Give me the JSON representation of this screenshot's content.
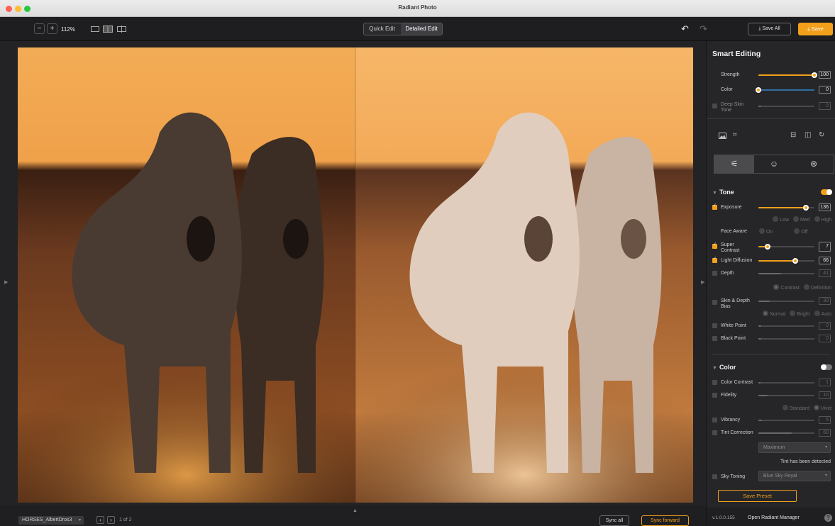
{
  "window": {
    "title": "Radiant Photo"
  },
  "toolbar": {
    "zoom_out": "−",
    "zoom_in": "+",
    "zoom_level": "112%",
    "mode_quick": "Quick Edit",
    "mode_detailed": "Detailed Edit",
    "undo": "↶",
    "redo": "↷",
    "save_all": "⤓ Save All",
    "save": "⤓ Save"
  },
  "bottom": {
    "filename": "HORSES_AlbertDros3",
    "page_prev": "‹",
    "page_next": "›",
    "page_count": "1 of 2",
    "sync_all": "Sync all",
    "sync_forward": "Sync forward",
    "expand": "▲"
  },
  "smart": {
    "title": "Smart Editing",
    "strength": {
      "label": "Strength",
      "value": "100",
      "level": 1.0
    },
    "color": {
      "label": "Color",
      "value": "0",
      "level": 0.0
    },
    "deep_skin": {
      "label": "Deep Skin Tone",
      "value": "0",
      "level": 0.0
    }
  },
  "tone": {
    "title": "Tone",
    "exposure": {
      "label": "Exposure",
      "value": "136",
      "level": 0.85
    },
    "exposure_opts": [
      "Low",
      "Med",
      "High"
    ],
    "face_aware": {
      "label": "Face Aware",
      "opts": [
        "On",
        "Off"
      ]
    },
    "super_contrast": {
      "label": "Super Contrast",
      "value": "7",
      "level": 0.17
    },
    "light_diffusion": {
      "label": "Light Diffusion",
      "value": "66",
      "level": 0.66
    },
    "depth": {
      "label": "Depth",
      "value": "41",
      "level": 0.41
    },
    "depth_opts": [
      "Contrast",
      "Definition"
    ],
    "skin_depth": {
      "label": "Skin & Depth Bias",
      "value": "30",
      "level": 0.2
    },
    "skin_opts": [
      "Normal",
      "Bright",
      "Auto"
    ],
    "white_point": {
      "label": "White Point",
      "value": "0",
      "level": 0.05
    },
    "black_point": {
      "label": "Black Point",
      "value": "0",
      "level": 0.05
    }
  },
  "color": {
    "title": "Color",
    "color_contrast": {
      "label": "Color Contrast",
      "value": "1",
      "level": 0.04
    },
    "fidelity": {
      "label": "Fidelity",
      "value": "10",
      "level": 0.16
    },
    "fidelity_opts": [
      "Standard",
      "Vivid"
    ],
    "vibrancy": {
      "label": "Vibrancy",
      "value": "5",
      "level": 0.06
    },
    "tint_correction": {
      "label": "Tint Correction",
      "value": "60",
      "level": 0.6
    },
    "tint_mode": "Maximum",
    "tint_note": "Tint has been detected",
    "sky_toning": {
      "label": "Sky Toning",
      "value": "Blue Sky Royal"
    }
  },
  "panel_footer": {
    "save_preset": "Save Preset",
    "version": "v.1.0.0.155",
    "open_manager": "Open Radiant Manager",
    "help": "?"
  },
  "icons": {
    "tab_adjust": "⚟",
    "tab_portrait": "☺",
    "tab_color": "⊛"
  },
  "colors": {
    "accent": "#f2a01c",
    "panel_bg": "#262628"
  }
}
